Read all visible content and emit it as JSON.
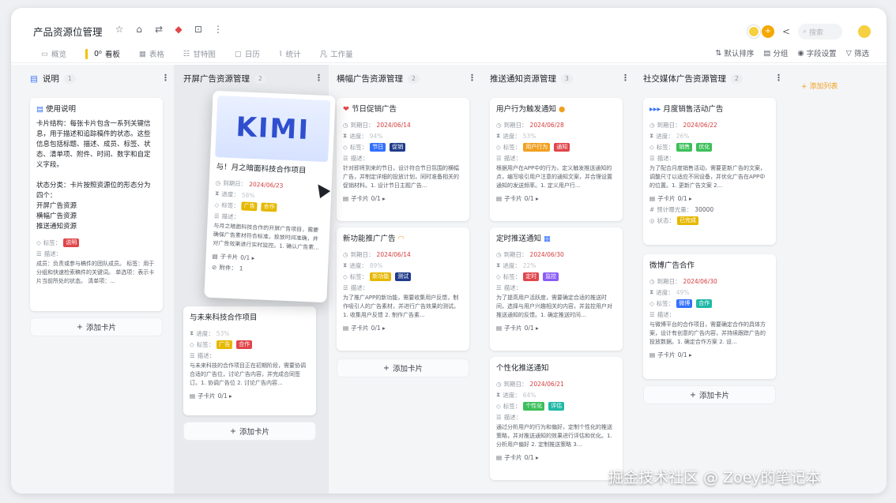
{
  "app": {
    "title": "产品资源位管理",
    "search_placeholder": "搜索",
    "icons": [
      "star-icon",
      "lock-icon",
      "swap-icon",
      "app-icon",
      "robot-icon",
      "more-icon"
    ]
  },
  "views": [
    {
      "icon": "▭",
      "label": "概览"
    },
    {
      "icon": "0⁰",
      "label": "看板"
    },
    {
      "icon": "▦",
      "label": "表格"
    },
    {
      "icon": "☷",
      "label": "甘特图"
    },
    {
      "icon": "▢",
      "label": "日历"
    },
    {
      "icon": "⌇",
      "label": "统计"
    },
    {
      "icon": "凡",
      "label": "工作量"
    }
  ],
  "view_options": [
    {
      "icon": "⇅",
      "label": "默认排序"
    },
    {
      "icon": "▤",
      "label": "分组"
    },
    {
      "icon": "◉",
      "label": "字段设置"
    },
    {
      "icon": "▽",
      "label": "筛选"
    }
  ],
  "labels": {
    "due": "到期日：",
    "progress": "进度：",
    "tags": "标签：",
    "desc": "描述：",
    "subcards": "子卡片",
    "attach": "附件：",
    "status": "状态：",
    "expose": "预计曝光量：",
    "add_card": "添加卡片",
    "add_group": "+ 添加列表"
  },
  "columns": [
    {
      "title": "说明",
      "count": "1"
    },
    {
      "title": "开屏广告资源管理",
      "count": "2"
    },
    {
      "title": "横幅广告资源管理",
      "count": "2"
    },
    {
      "title": "推送通知资源管理",
      "count": "3"
    },
    {
      "title": "社交媒体广告资源管理",
      "count": "2"
    }
  ],
  "note": {
    "title": "使用说明",
    "body": "卡片结构：每张卡片包含一系列关键信息，用于描述和追踪稿件的状态。这些信息包括标题、描述、成员、标签、状态、清单项、附件、时间、数字和自定义字段。\n\n状态分类：卡片按照资源位的形态分为四个：\n开屏广告资源\n横幅广告资源\n推送通知资源",
    "tag": "说明",
    "desc": "成员：负责或参与稿件的团队成员。 标签：用于分组和快速检索稿件的关键词。 单选项：表示卡片当前所处的状态。 清单项：..."
  },
  "float_card": {
    "logo": "KIMI",
    "title": "与！月之暗面科技合作项目",
    "due": "2024/06/23",
    "progress": "58%",
    "tags": [
      "广告",
      "合作"
    ],
    "desc": "与月之暗面科技合作的开屏广告项目，需要确保广告素材符合标准，投放时间准确，并对广告效果进行实时监控。1. 确认广告素...",
    "sub": "0/1 ▸",
    "attach": "1"
  },
  "card_future": {
    "title": "与未来科技合作项目",
    "progress": "53%",
    "tags": [
      "广告",
      "合作"
    ],
    "desc": "与未来科技的合作项目正在初期阶段，需要协调合适的广告位，讨论广告内容，并完成合同签订。1. 协调广告位 2. 讨论广告内容...",
    "sub": "0/1 ▸"
  },
  "card_festival": {
    "title": "节日促销广告",
    "due": "2024/06/14",
    "progress": "94%",
    "tags": [
      "节日",
      "促销"
    ],
    "desc": "针对即将到来的节日，设计符合节日氛围的横幅广告，并制定详细的投放计划，同时准备相关的促销材料。1. 设计节日主题广告...",
    "sub": "0/1 ▸"
  },
  "card_newfunc": {
    "title": "新功能推广广告",
    "due": "2024/06/14",
    "progress": "89%",
    "tags": [
      "新功能",
      "测试"
    ],
    "desc": "为了推广APP的新功能，需要收集用户反馈，制作吸引人的广告素材，并进行广告效果的测试。1. 收集用户反馈 2. 制作广告素...",
    "sub": "0/1 ▸"
  },
  "card_trigger": {
    "title": "用户行为触发通知",
    "due": "2024/06/28",
    "progress": "53%",
    "tags": [
      "用户行为",
      "通知"
    ],
    "desc": "根据用户在APP中的行为，定义触发推送通知的点，编写吸引用户注意的通知文案，并合理设置通知的发送频率。1. 定义用户行...",
    "sub": "0/1 ▸"
  },
  "card_timed": {
    "title": "定时推送通知",
    "due": "2024/06/30",
    "progress": "22%",
    "tags": [
      "定时",
      "监控"
    ],
    "desc": "为了提高用户活跃度，需要确定合适的推送时间，选择与用户兴趣相关的内容，并监控用户对推送通知的反馈。1. 确定推送时间...",
    "sub": "0/1 ▸"
  },
  "card_personal": {
    "title": "个性化推送通知",
    "due": "2024/06/21",
    "progress": "64%",
    "tags": [
      "个性化",
      "评估"
    ],
    "desc": "通过分析用户的行为和偏好，定制个性化的推送策略，并对推送通知的效果进行评估和优化。1. 分析用户偏好 2. 定制推送策略 3...",
    "sub": "0/1 ▸"
  },
  "card_monthly": {
    "title": "月度销售活动广告",
    "due": "2024/06/22",
    "progress": "26%",
    "tags": [
      "销售",
      "优化"
    ],
    "desc": "为了配合月度销售活动，需要更新广告的文案，调整尺寸以适应不同设备，并优化广告在APP中的位置。1. 更新广告文案 2...",
    "sub": "0/1 ▸",
    "expose": "30000",
    "status": "已完成"
  },
  "card_weibo": {
    "title": "微博广告合作",
    "due": "2024/06/30",
    "progress": "49%",
    "tags": [
      "微博",
      "合作"
    ],
    "desc": "与微博平台的合作项目，需要确定合作的具体方案，设计有创意的广告内容，并持续跟踪广告的投放数据。1. 确定合作方案 2. 设...",
    "sub": "0/1 ▸"
  },
  "watermark": "掘金技术社区 @ Zoey的笔记本",
  "colors": {
    "accent": "#f5c000",
    "red": "#e0464b",
    "orange": "#f0a020",
    "teal": "#1fb8a6",
    "blue": "#3370ff",
    "purple": "#8a5cf5",
    "green": "#3bbf58",
    "yellow": "#e6b800",
    "navy": "#1f3b8a"
  }
}
